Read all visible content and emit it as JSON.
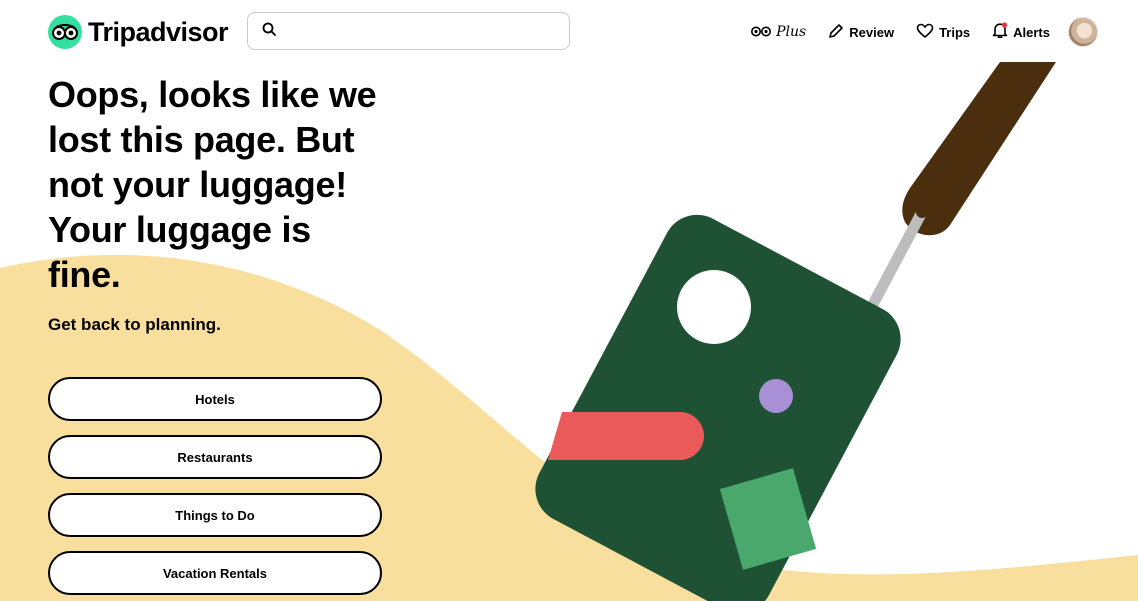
{
  "header": {
    "logo_text": "Tripadvisor",
    "search": {
      "placeholder": "",
      "value": ""
    },
    "nav": {
      "plus_label": "Plus",
      "review_label": "Review",
      "trips_label": "Trips",
      "alerts_label": "Alerts"
    }
  },
  "main": {
    "headline": "Oops, looks like we lost this page. But not your luggage! Your luggage is fine.",
    "subline": "Get back to planning.",
    "links": [
      {
        "label": "Hotels"
      },
      {
        "label": "Restaurants"
      },
      {
        "label": "Things to Do"
      },
      {
        "label": "Vacation Rentals"
      }
    ]
  },
  "colors": {
    "brand_green": "#34e0a1",
    "sand": "#f9df9d",
    "luggage_green": "#1f5134",
    "handle_brown": "#4a2e0e",
    "accent_red": "#eb5a5a",
    "accent_purple": "#a98fd6",
    "accent_light_green": "#4aa86c"
  }
}
